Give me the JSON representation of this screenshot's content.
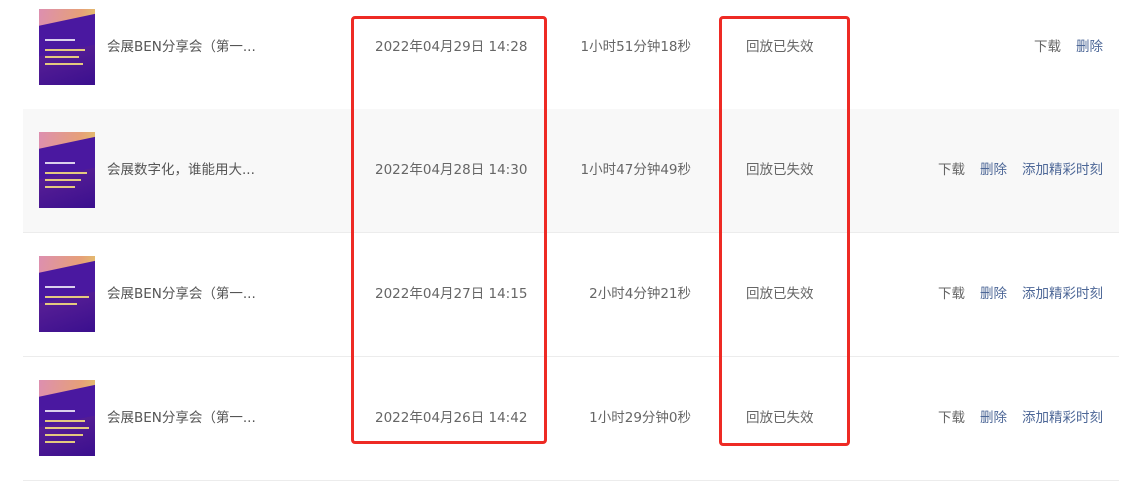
{
  "rows": [
    {
      "title": "会展BEN分享会（第一...",
      "date": "2022年04月29日 14:28",
      "duration": "1小时51分钟18秒",
      "status": "回放已失效",
      "actions": [
        "下载",
        "删除"
      ]
    },
    {
      "title": "会展数字化，谁能用大...",
      "date": "2022年04月28日 14:30",
      "duration": "1小时47分钟49秒",
      "status": "回放已失效",
      "actions": [
        "下载",
        "删除",
        "添加精彩时刻"
      ]
    },
    {
      "title": "会展BEN分享会（第一...",
      "date": "2022年04月27日 14:15",
      "duration": "2小时4分钟21秒",
      "status": "回放已失效",
      "actions": [
        "下载",
        "删除",
        "添加精彩时刻"
      ]
    },
    {
      "title": "会展BEN分享会（第一...",
      "date": "2022年04月26日 14:42",
      "duration": "1小时29分钟0秒",
      "status": "回放已失效",
      "actions": [
        "下载",
        "删除",
        "添加精彩时刻"
      ]
    }
  ],
  "colors": {
    "highlight": "#ee2a24",
    "action_link": "#4d6797",
    "row_alt": "#f8f8f8"
  }
}
